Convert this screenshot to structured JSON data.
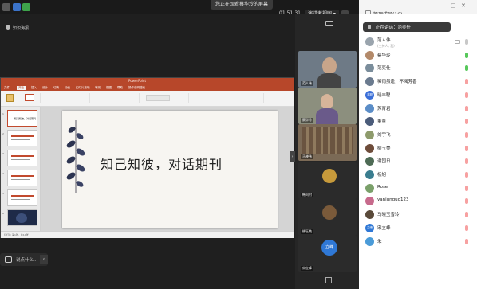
{
  "top_bar": {
    "share_banner": "您正在观看蔡华玲的屏幕",
    "timer": "01:51:31",
    "view_mode": "演讲者视图",
    "participants_button": "管理成员(16)"
  },
  "local_user": {
    "name": "知识海报"
  },
  "ppt": {
    "file_title": "PowerPoint",
    "tabs": [
      "文件",
      "开始",
      "插入",
      "设计",
      "切换",
      "动画",
      "幻灯片放映",
      "审阅",
      "视图",
      "帮助",
      "操作说明搜索"
    ],
    "slide_title": "知己知彼，对话期刊",
    "thumbnails": [
      "1",
      "2",
      "3",
      "4",
      "5",
      "6"
    ],
    "status": "幻灯片 第1张，共14张"
  },
  "chat": {
    "placeholder": "说点什么..."
  },
  "video_tiles": [
    {
      "name": "范人伟",
      "bg": "#6e7a86"
    },
    {
      "name": "蔡华玲",
      "bg": "#8c8f7e"
    },
    {
      "name": "马晓伟",
      "bg": "#7b6a56"
    },
    {
      "name": "韩向村",
      "bg": "#2b2b2b"
    },
    {
      "name": "柳玉美",
      "bg": "#2b2b2b"
    },
    {
      "name": "宋立峰",
      "bg": "#2b2b2b",
      "avatar_text": "立峰"
    }
  ],
  "speaking_indicator": "正在讲话：范奕仕",
  "participants": [
    {
      "name": "范人伟",
      "sub": "(主持人, 我)",
      "color": "#9aa4ad",
      "mic": "idle"
    },
    {
      "name": "蔡华玲",
      "sub": "",
      "color": "#b38a6a",
      "mic": "on"
    },
    {
      "name": "范奕仕",
      "sub": "",
      "color": "#7a8d9b",
      "mic": "on"
    },
    {
      "name": "稀雨虽逢，不阅芳香",
      "sub": "",
      "color": "#6b7b8f",
      "mic": "off"
    },
    {
      "name": "晓丰聪",
      "sub": "",
      "color": "#3b6fd8",
      "mic": "off",
      "avatar_text": "丰聪"
    },
    {
      "name": "苏育君",
      "sub": "",
      "color": "#5b8dc7",
      "mic": "off"
    },
    {
      "name": "董董",
      "sub": "",
      "color": "#4b5c7a",
      "mic": "off"
    },
    {
      "name": "刘宇飞",
      "sub": "",
      "color": "#8e9b6c",
      "mic": "off"
    },
    {
      "name": "柳玉美",
      "sub": "",
      "color": "#6e4c3a",
      "mic": "off"
    },
    {
      "name": "谢国日",
      "sub": "",
      "color": "#4e6b55",
      "mic": "off"
    },
    {
      "name": "杨旭",
      "sub": "",
      "color": "#3a7d8f",
      "mic": "off"
    },
    {
      "name": "Rose",
      "sub": "",
      "color": "#7aa06a",
      "mic": "off"
    },
    {
      "name": "yanjunguo123",
      "sub": "",
      "color": "#c76a8c",
      "mic": "off"
    },
    {
      "name": "马晓玉雪玲",
      "sub": "",
      "color": "#5a4a3a",
      "mic": "off"
    },
    {
      "name": "宋立峰",
      "sub": "",
      "color": "#2f78d6",
      "mic": "off",
      "avatar_text": "立峰"
    },
    {
      "name": "朱",
      "sub": "",
      "color": "#4a9bd8",
      "mic": "off"
    }
  ]
}
